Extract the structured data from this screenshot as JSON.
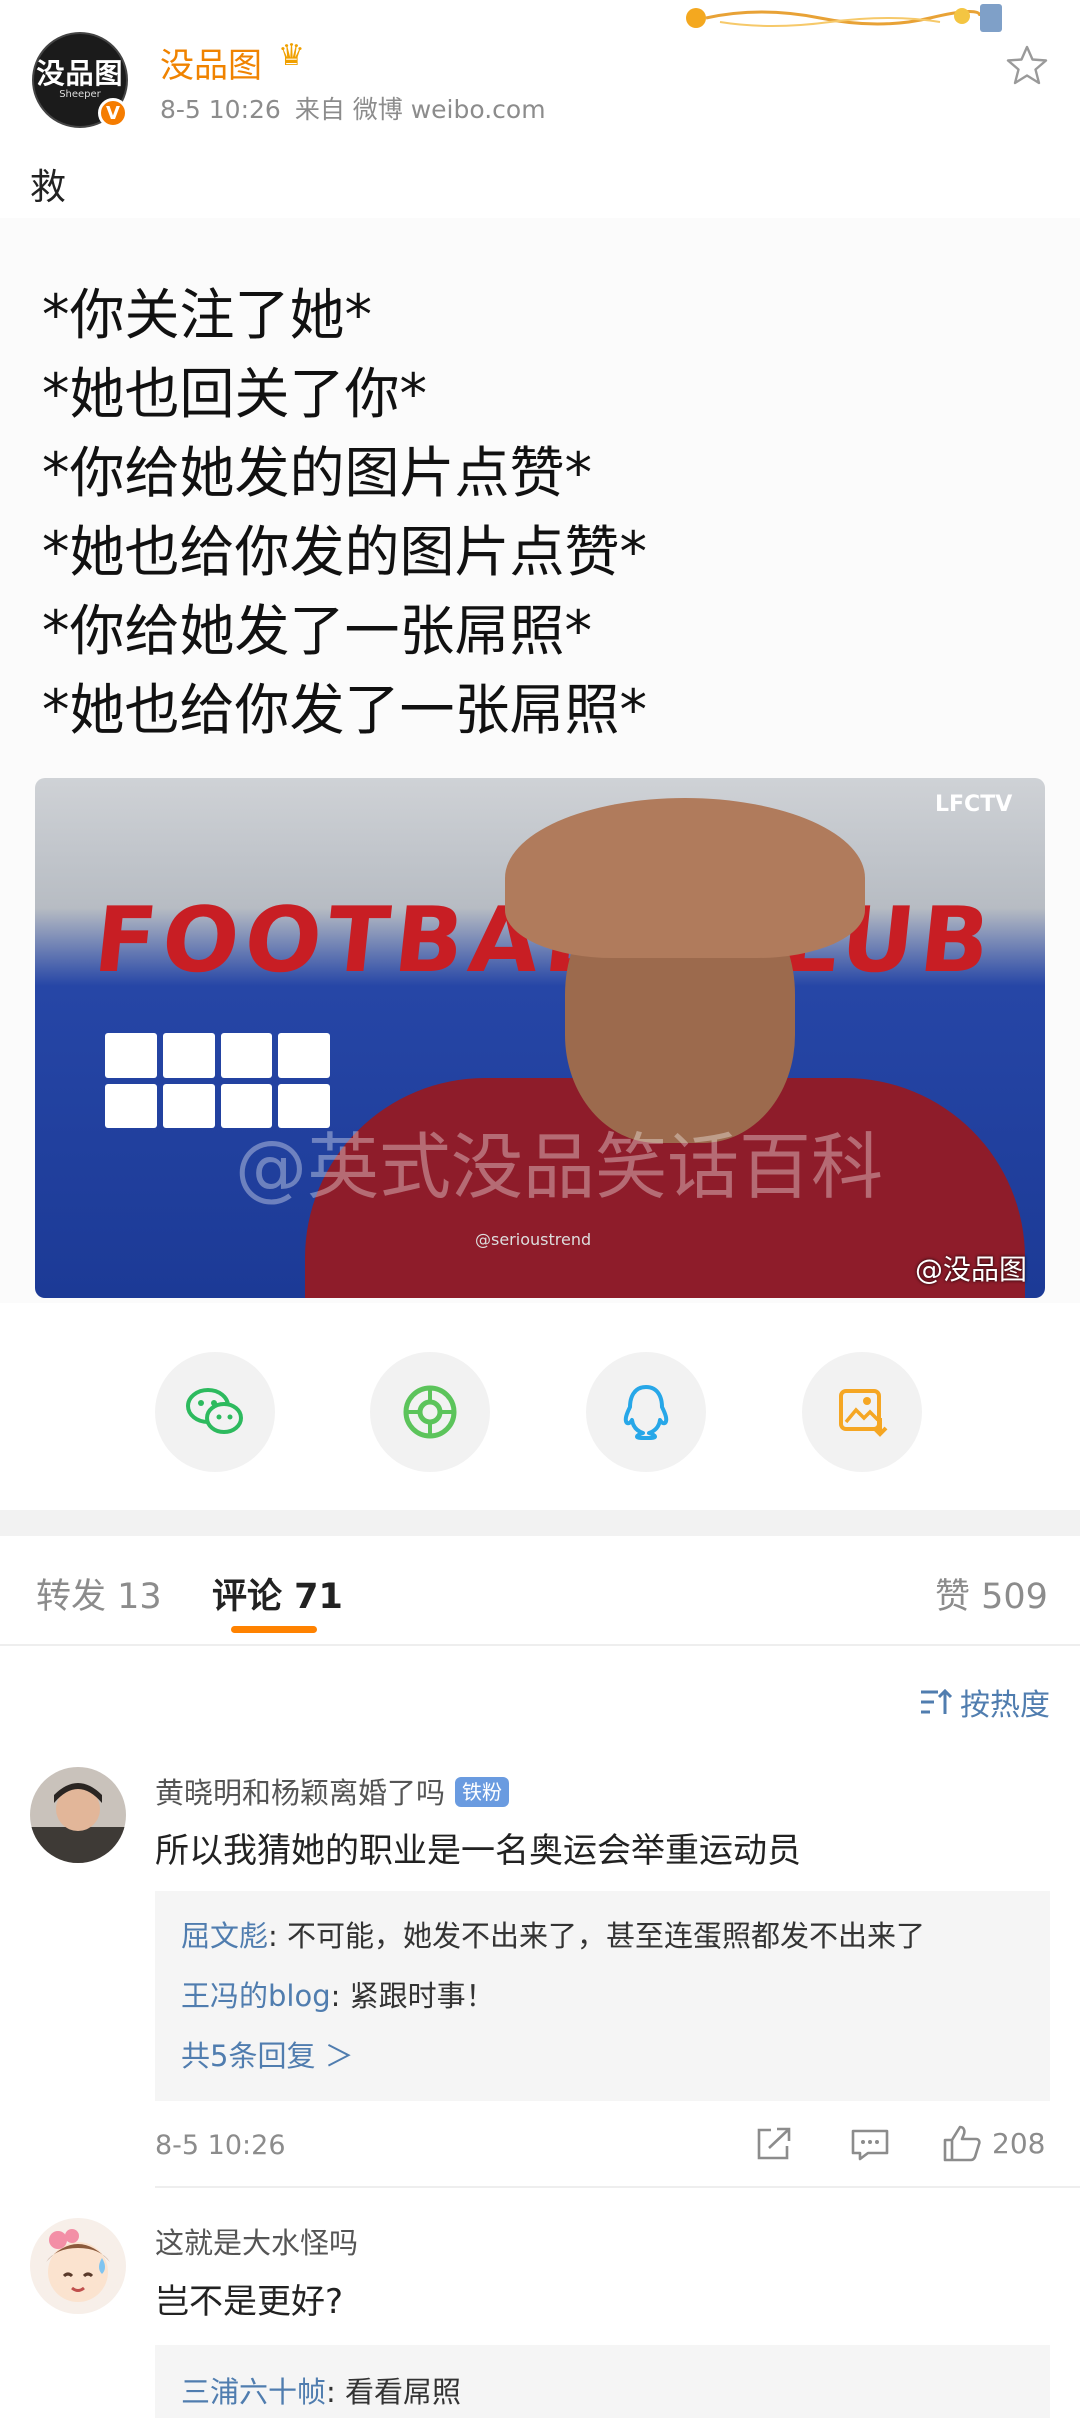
{
  "post": {
    "username": "没品图",
    "avatar_text": "没品图",
    "avatar_sub": "Sheeper",
    "time": "8-5 10:26",
    "source": "来自 微博 weibo.com",
    "text": "救",
    "meme_lines": [
      "*你关注了她*",
      "*她也回关了你*",
      "*你给她发的图片点赞*",
      "*她也给你发的图片点赞*",
      "*你给她发了一张屌照*",
      "*她也给你发了一张屌照*"
    ],
    "image_wall_text": "FOOTBALL CLUB",
    "image_lfctv": "LFCTV",
    "image_watermark": "@英式没品笑话百科",
    "image_credit": "@没品图",
    "image_small_credit": "@serioustrend"
  },
  "share": {
    "icons": [
      "wechat-icon",
      "moments-icon",
      "qq-icon",
      "save-image-icon"
    ]
  },
  "tabs": {
    "repost": "转发 13",
    "comments": "评论 71",
    "likes": "赞 509"
  },
  "sort_label": "按热度",
  "comments": [
    {
      "name": "黄晓明和杨颖离婚了吗",
      "badge": "铁粉",
      "text": "所以我猜她的职业是一名奥运会举重运动员",
      "replies": [
        {
          "name": "屈文彪",
          "text": ": 不可能，她发不出来了，甚至连蛋照都发不出来了"
        },
        {
          "name": "王冯的blog",
          "text": ": 紧跟时事！"
        }
      ],
      "more": "共5条回复 ＞",
      "time": "8-5 10:26",
      "likes": "208"
    },
    {
      "name": "这就是大水怪吗",
      "text": "岂不是更好?",
      "replies": [
        {
          "name": "三浦六十帧",
          "text": ": 看看屌照"
        }
      ]
    }
  ],
  "colors": {
    "accent": "#ff8200",
    "username": "#f08300",
    "link": "#507daf"
  }
}
